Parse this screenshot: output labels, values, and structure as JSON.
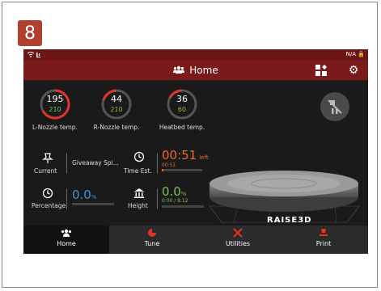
{
  "step_badge": "8",
  "status": {
    "left_icons": "wifi-signal",
    "right": "N/A"
  },
  "header": {
    "title": "Home"
  },
  "gauges": [
    {
      "current": "195",
      "target": "210",
      "label": "L-Nozzle temp."
    },
    {
      "current": "44",
      "target": "210",
      "label": "R-Nozzle temp."
    },
    {
      "current": "36",
      "target": "60",
      "label": "Heatbed temp."
    }
  ],
  "info": {
    "current_label": "Current",
    "current_file": "Giveaway Spi...",
    "time_label": "Time Est.",
    "time_left": "00:51",
    "time_left_suffix": "left",
    "time_elapsed": "00:51",
    "percentage_label": "Percentage",
    "percentage_value": "0.0",
    "percentage_unit": "%",
    "height_label": "Height",
    "height_value": "0.0",
    "height_unit": "%",
    "height_detail": "0.00 / 8.12"
  },
  "brand": "RAISE3D",
  "tabs": [
    {
      "label": "Home"
    },
    {
      "label": "Tune"
    },
    {
      "label": "Utilities"
    },
    {
      "label": "Print"
    }
  ],
  "colors": {
    "accent_red": "#e0332a",
    "header_bg": "#7a1a1a",
    "green": "#7fc04a",
    "blue": "#3a9ad9",
    "orange": "#e86a2a"
  }
}
